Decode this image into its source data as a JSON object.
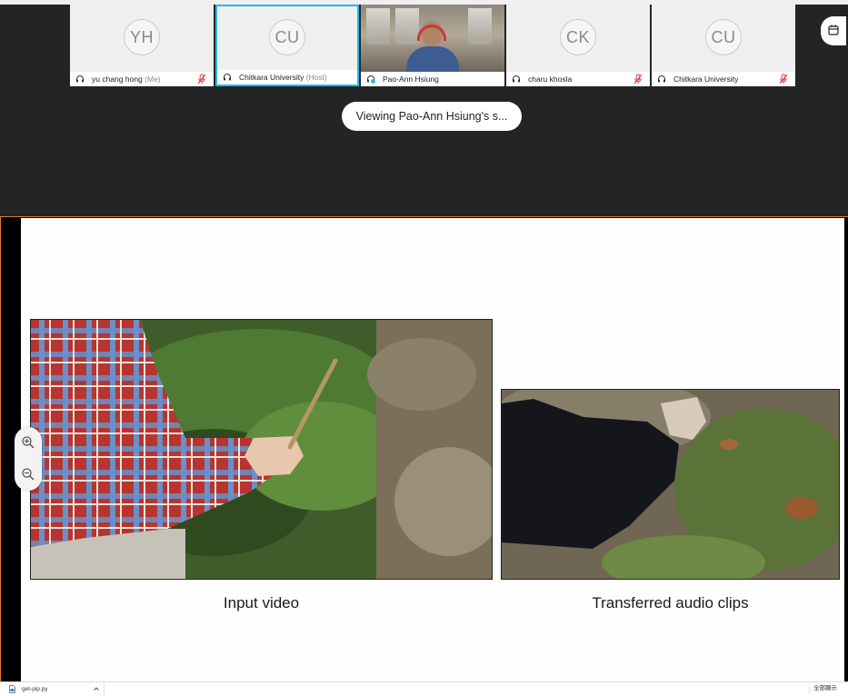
{
  "participants": [
    {
      "initials": "YH",
      "name": "yu chang hong",
      "tag": "(Me)",
      "muted": true
    },
    {
      "initials": "CU",
      "name": "Chitkara University",
      "tag": "(Host)",
      "muted": false,
      "active": true
    },
    {
      "initials": "",
      "name": "Pao-Ann Hsiung",
      "tag": "",
      "muted": false,
      "video": true
    },
    {
      "initials": "CK",
      "name": "charu khosla",
      "tag": "",
      "muted": true
    },
    {
      "initials": "CU",
      "name": "Chitkara University",
      "tag": "",
      "muted": true
    }
  ],
  "viewing_text": "Viewing Pao-Ann Hsiung's s...",
  "slide": {
    "caption_left": "Input video",
    "caption_right": "Transferred audio clips"
  },
  "download_bar": {
    "file_name": "get-pip.py",
    "show_all": "全部顯示"
  },
  "icons": {
    "headset": "headset-icon",
    "muted_mic": "muted-mic-icon",
    "zoom_in": "zoom-in-icon",
    "zoom_out": "zoom-out-icon",
    "calendar": "calendar-icon"
  },
  "colors": {
    "active_border": "#21b9ee",
    "muted_red": "#d93d3d",
    "share_border": "#e07a2a"
  }
}
